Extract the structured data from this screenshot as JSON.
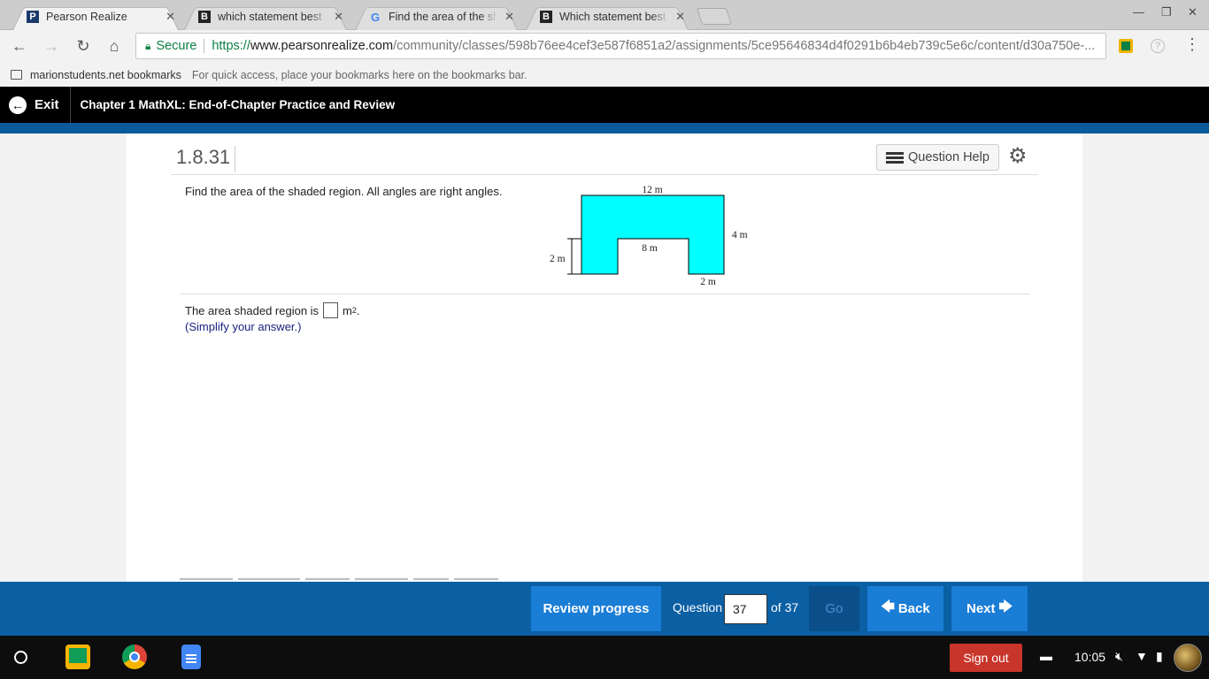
{
  "browser": {
    "tabs": [
      {
        "title": "Pearson Realize",
        "favicon": "P",
        "active": true
      },
      {
        "title": "which statement best ex",
        "favicon": "B",
        "active": false
      },
      {
        "title": "Find the area of the sha",
        "favicon": "G",
        "active": false
      },
      {
        "title": "Which statement best e",
        "favicon": "B",
        "active": false
      }
    ],
    "secure_label": "Secure",
    "url_scheme": "https://",
    "url_host": "www.pearsonrealize.com",
    "url_path": "/community/classes/598b76ee4cef3e587f6851a2/assignments/5ce95646834d4f0291b6b4eb739c5e6c/content/d30a750e-...",
    "bookmarks_folder": "marionstudents.net bookmarks",
    "bookmarks_hint": "For quick access, place your bookmarks here on the bookmarks bar."
  },
  "header": {
    "exit_label": "Exit",
    "chapter_title": "Chapter 1 MathXL: End-of-Chapter Practice and Review"
  },
  "question": {
    "number": "1.8.31",
    "help_label": "Question Help",
    "prompt": "Find the area of the shaded region. All angles are right angles.",
    "answer_prefix": "The area shaded region is",
    "answer_unit": "m",
    "answer_unit_exp": "2",
    "answer_suffix": ".",
    "hint": "(Simplify your answer.)",
    "figure": {
      "fill_color": "#00ffff",
      "labels": {
        "top_width": "12 m",
        "right_height": "4 m",
        "notch_width": "8 m",
        "leg_height": "2 m",
        "leg_width": "2 m"
      }
    }
  },
  "footer": {
    "review_label": "Review progress",
    "question_label": "Question",
    "question_value": "37",
    "of_label": "of 37",
    "go_label": "Go",
    "back_label": "Back",
    "next_label": "Next"
  },
  "shelf": {
    "signout_label": "Sign out",
    "clock": "10:05"
  },
  "colors": {
    "accent_blue": "#0b5fa3",
    "button_blue": "#1a7dd6",
    "signout_red": "#c8352b"
  }
}
